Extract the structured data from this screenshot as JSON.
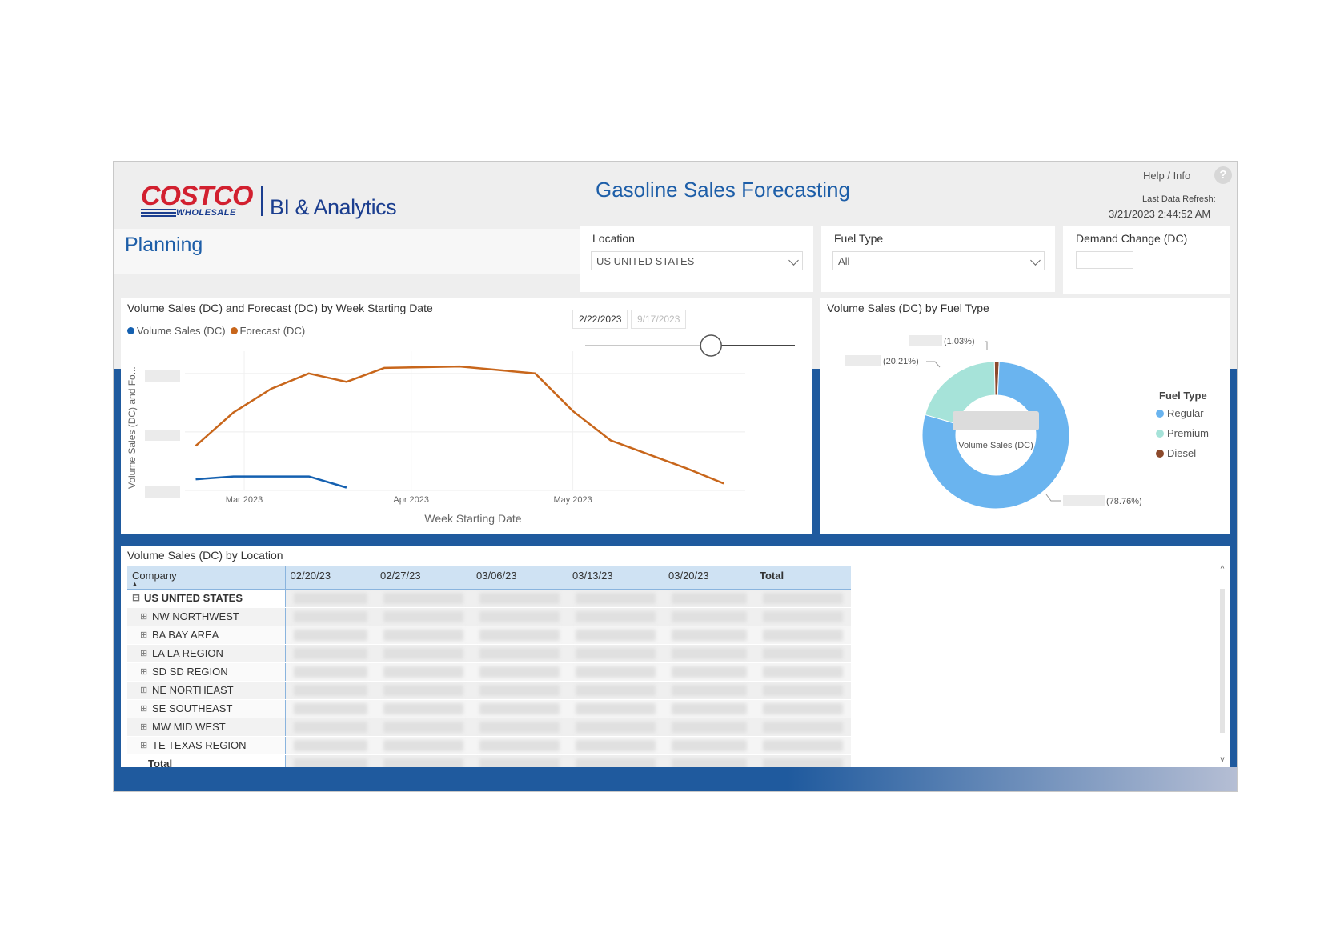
{
  "header": {
    "brand_logo": "COSTCO",
    "brand_sub": "WHOLESALE",
    "brand_product": "BI & Analytics",
    "app_title": "Gasoline Sales Forecasting",
    "help_label": "Help / Info",
    "help_icon": "?",
    "refresh_label": "Last Data Refresh:",
    "refresh_value": "3/21/2023 2:44:52 AM",
    "page_title": "Planning"
  },
  "filters": {
    "location": {
      "label": "Location",
      "value": "US UNITED STATES"
    },
    "fuel_type": {
      "label": "Fuel Type",
      "value": "All"
    },
    "demand_change": {
      "label": "Demand Change (DC)",
      "value": ""
    }
  },
  "line_card": {
    "title": "Volume Sales (DC) and Forecast (DC) by Week Starting Date",
    "legend": [
      {
        "name": "Volume Sales (DC)",
        "color": "#1460b0"
      },
      {
        "name": "Forecast (DC)",
        "color": "#c8661b"
      }
    ],
    "date_start": "2/22/2023",
    "date_end": "9/17/2023",
    "slider_position": 0.6,
    "ylabel": "Volume Sales (DC) and Fo...",
    "xlabel": "Week Starting Date"
  },
  "donut_card": {
    "title": "Volume Sales (DC) by Fuel Type",
    "center_label": "Volume Sales (DC)",
    "legend_title": "Fuel Type",
    "data_labels": [
      "(1.03%)",
      "(20.21%)",
      "(78.76%)"
    ]
  },
  "matrix_card": {
    "title": "Volume Sales (DC) by Location",
    "columns": [
      "Company",
      "02/20/23",
      "02/27/23",
      "03/06/23",
      "03/13/23",
      "03/20/23",
      "Total"
    ],
    "expand_glyph": "⊟",
    "collapse_glyph": "⊞",
    "sort_glyph": "▲",
    "parent_row": "US UNITED STATES",
    "child_rows": [
      "NW NORTHWEST",
      "BA BAY AREA",
      "LA LA REGION",
      "SD SD REGION",
      "NE NORTHEAST",
      "SE SOUTHEAST",
      "MW MID WEST",
      "TE TEXAS REGION"
    ],
    "total_label": "Total",
    "scroll_up": "^",
    "scroll_down": "v"
  },
  "chart_data": [
    {
      "type": "line",
      "title": "Volume Sales (DC) and Forecast (DC) by Week Starting Date",
      "xlabel": "Week Starting Date",
      "ylabel": "Volume Sales (DC) and Fo...",
      "x_ticks": [
        "Mar 2023",
        "Apr 2023",
        "May 2023"
      ],
      "x": [
        "2023-02-20",
        "2023-02-27",
        "2023-03-06",
        "2023-03-13",
        "2023-03-20",
        "2023-03-27",
        "2023-04-10",
        "2023-04-24",
        "2023-05-01",
        "2023-05-08",
        "2023-05-15",
        "2023-05-22",
        "2023-05-29"
      ],
      "ylim": [
        0,
        100
      ],
      "grid": true,
      "legend_position": "top-left",
      "series": [
        {
          "name": "Volume Sales (DC)",
          "color": "#1460b0",
          "values": [
            8,
            10,
            10,
            10,
            2,
            null,
            null,
            null,
            null,
            null,
            null,
            null,
            null
          ]
        },
        {
          "name": "Forecast (DC)",
          "color": "#c8661b",
          "values": [
            32,
            56,
            73,
            84,
            78,
            88,
            89,
            84,
            57,
            36,
            26,
            16,
            5
          ]
        }
      ]
    },
    {
      "type": "pie",
      "title": "Volume Sales (DC) by Fuel Type",
      "hole": true,
      "legend_title": "Fuel Type",
      "legend_position": "right",
      "slices": [
        {
          "name": "Regular",
          "percent": 78.76,
          "color": "#6ab4ef"
        },
        {
          "name": "Premium",
          "percent": 20.21,
          "color": "#a6e3d9"
        },
        {
          "name": "Diesel",
          "percent": 1.03,
          "color": "#8c4a2c"
        }
      ]
    }
  ]
}
